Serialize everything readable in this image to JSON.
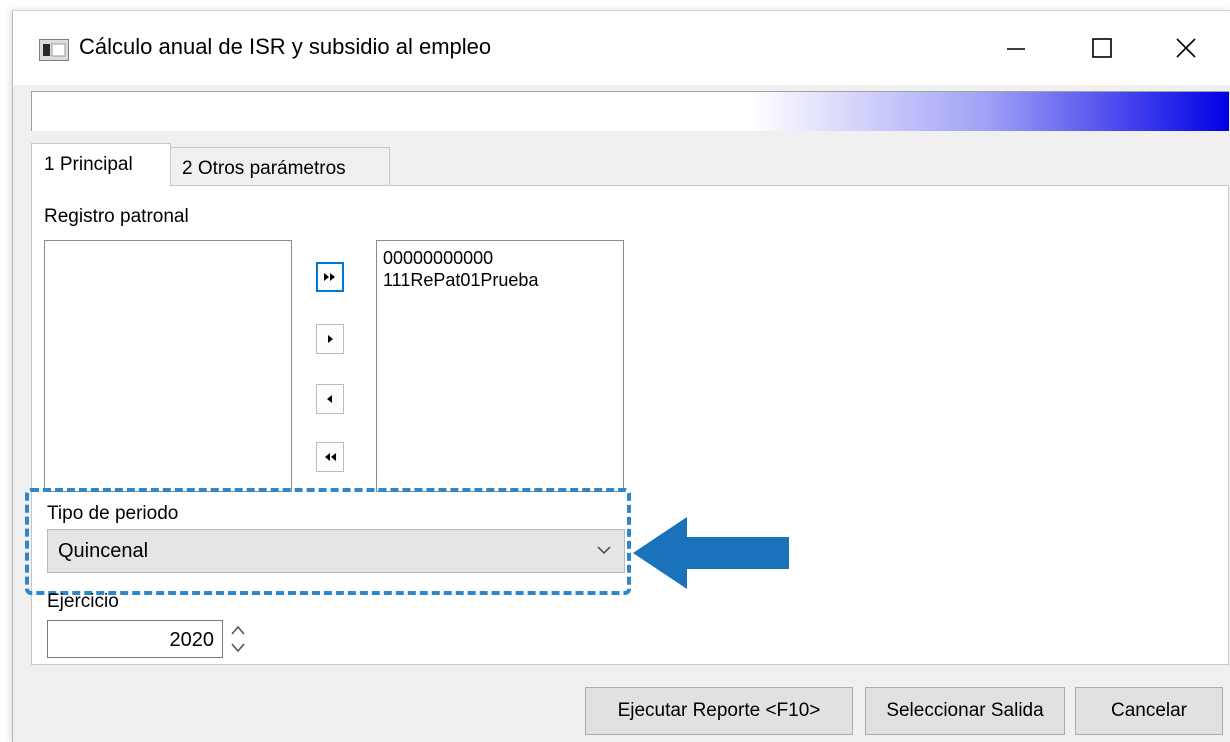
{
  "window": {
    "title": "Cálculo anual de ISR y subsidio al empleo",
    "app_icon": "window-app-icon",
    "controls": [
      "minimize-icon",
      "maximize-icon",
      "close-icon"
    ]
  },
  "progress": {
    "gradient_colors": [
      "#ffffff",
      "#9f9ff6",
      "#0000e6"
    ]
  },
  "tabs": [
    {
      "label": "1 Principal",
      "active": true
    },
    {
      "label": "2 Otros parámetros",
      "active": false
    }
  ],
  "registro_patronal": {
    "label": "Registro patronal",
    "available": [],
    "selected": [
      "00000000000",
      "111RePat01Prueba"
    ],
    "transfer_buttons": [
      "move-all-right-icon",
      "move-right-icon",
      "move-left-icon",
      "move-all-left-icon"
    ]
  },
  "tipo_periodo": {
    "label": "Tipo de periodo",
    "value": "Quincenal"
  },
  "ejercicio": {
    "label": "Ejercicio",
    "value": "2020"
  },
  "annotation": {
    "highlight_color": "#2f86c9",
    "arrow_color": "#1a72bb"
  },
  "buttons": {
    "run": "Ejecutar Reporte <F10>",
    "output": "Seleccionar Salida",
    "cancel": "Cancelar"
  }
}
